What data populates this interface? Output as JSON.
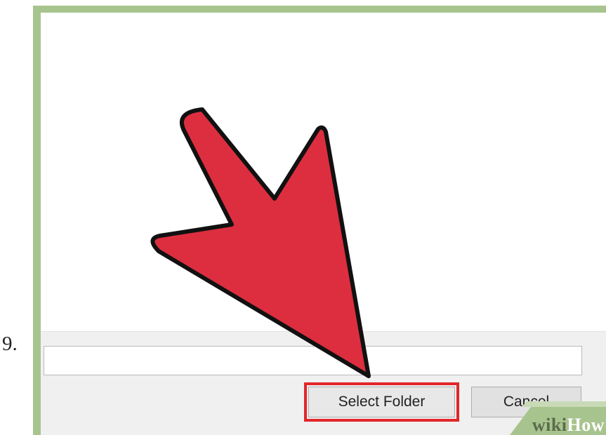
{
  "step": {
    "number": "9."
  },
  "dialog": {
    "path_value": "",
    "buttons": {
      "select_folder_label": "Select Folder",
      "cancel_label": "Cancel"
    }
  },
  "annotation": {
    "arrow_color": "#dd2e3f",
    "highlight_color": "#e2262a",
    "target": "select-folder-button"
  },
  "watermark": {
    "wiki": "wiki",
    "how": "How"
  },
  "colors": {
    "frame": "#a8c48e",
    "dialog_bar": "#f0f0f0",
    "button_face": "#e1e1e1"
  }
}
